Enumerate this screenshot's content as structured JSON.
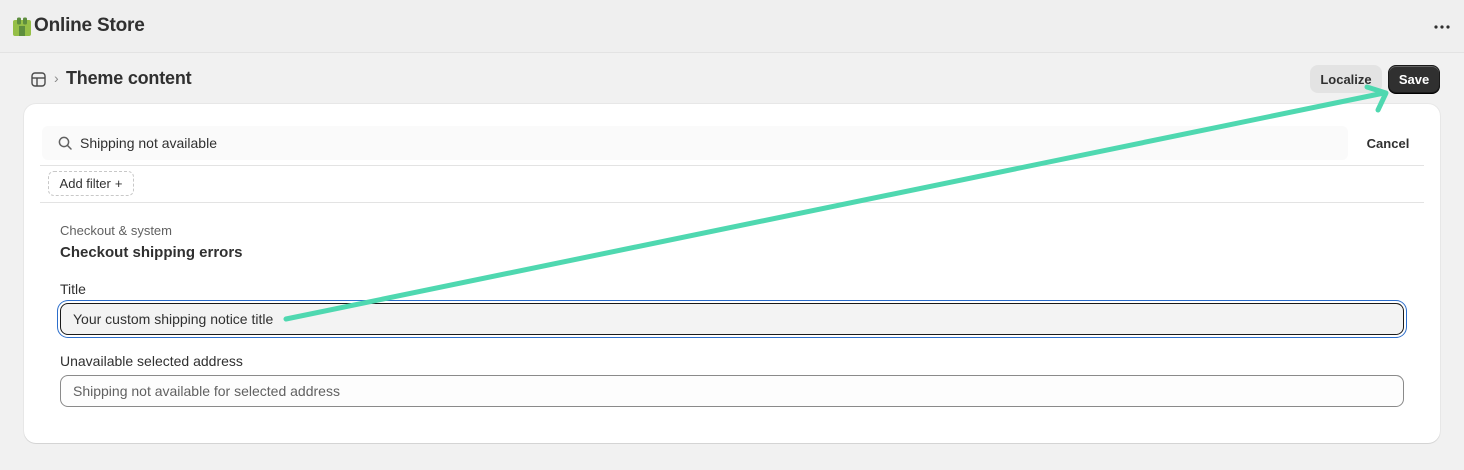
{
  "app": {
    "title": "Online Store",
    "logo_icon": "shopify-bag-icon"
  },
  "topbar": {
    "more_icon": "more-horizontal-icon"
  },
  "page": {
    "breadcrumb_icon": "theme-icon",
    "separator": "›",
    "title": "Theme content"
  },
  "actions": {
    "localize_label": "Localize",
    "save_label": "Save"
  },
  "search": {
    "value": "Shipping not available",
    "cancel_label": "Cancel",
    "icon": "search-icon"
  },
  "filter": {
    "add_label": "Add filter",
    "plus": "+"
  },
  "section": {
    "category": "Checkout & system",
    "title": "Checkout shipping errors",
    "fields": [
      {
        "label": "Title",
        "value": "Your custom shipping notice title",
        "placeholder": ""
      },
      {
        "label": "Unavailable selected address",
        "value": "",
        "placeholder": "Shipping not available for selected address"
      }
    ]
  },
  "annotation": {
    "arrow_color": "#4fd8b0"
  },
  "colors": {
    "primary_button": "#303030",
    "focus_ring": "#2c6ecb",
    "logo_green": "#95bf47"
  }
}
